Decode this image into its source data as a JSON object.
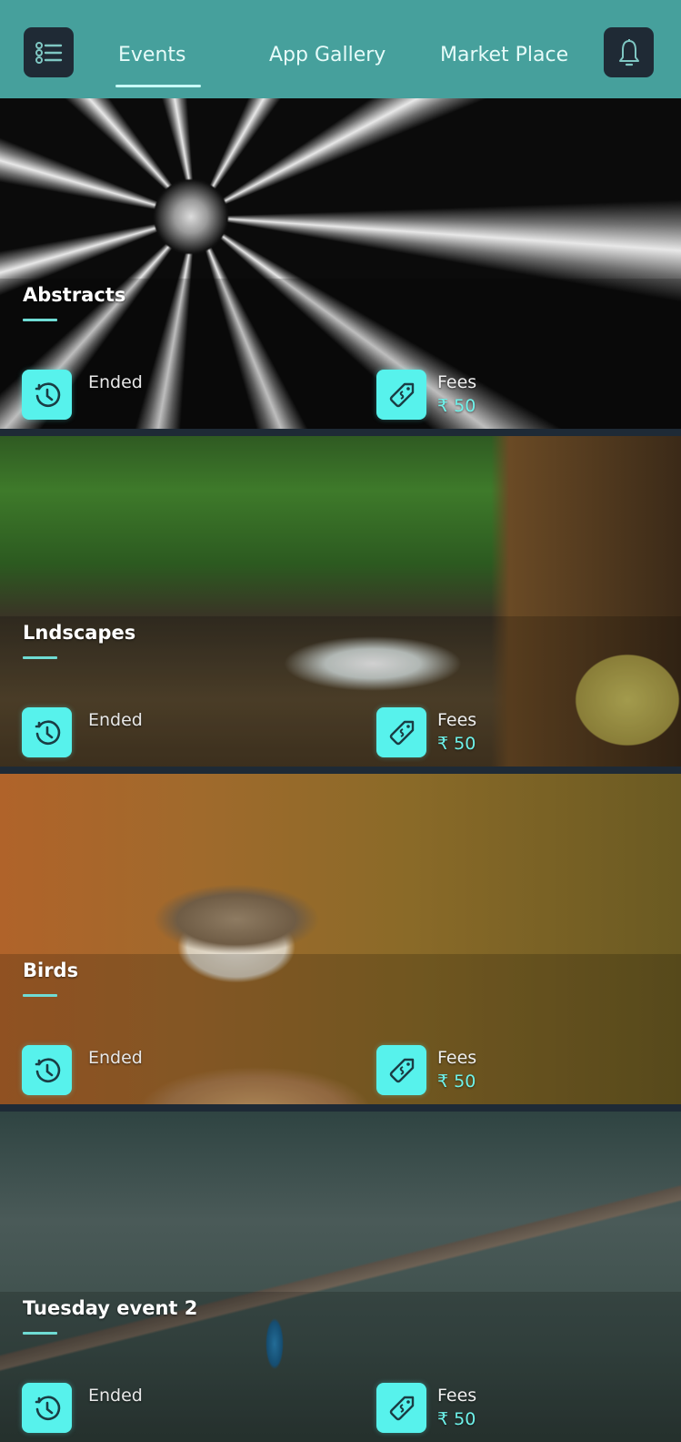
{
  "header": {
    "menu_icon": "list-menu-icon",
    "bell_icon": "bell-icon",
    "tabs": [
      {
        "label": "Events",
        "active": true
      },
      {
        "label": "App Gallery",
        "active": false
      },
      {
        "label": "Market Place",
        "active": false
      }
    ]
  },
  "colors": {
    "header_bg": "#46a09c",
    "accent": "#57f2ec",
    "page_bg": "#1e2a36"
  },
  "events": [
    {
      "title": "Abstracts",
      "status": "Ended",
      "fees_label": "Fees",
      "fees_value": "₹ 50"
    },
    {
      "title": "Lndscapes",
      "status": "Ended",
      "fees_label": "Fees",
      "fees_value": "₹ 50"
    },
    {
      "title": "Birds",
      "status": "Ended",
      "fees_label": "Fees",
      "fees_value": "₹ 50"
    },
    {
      "title": "Tuesday event 2",
      "status": "Ended",
      "fees_label": "Fees",
      "fees_value": "₹ 50"
    }
  ]
}
